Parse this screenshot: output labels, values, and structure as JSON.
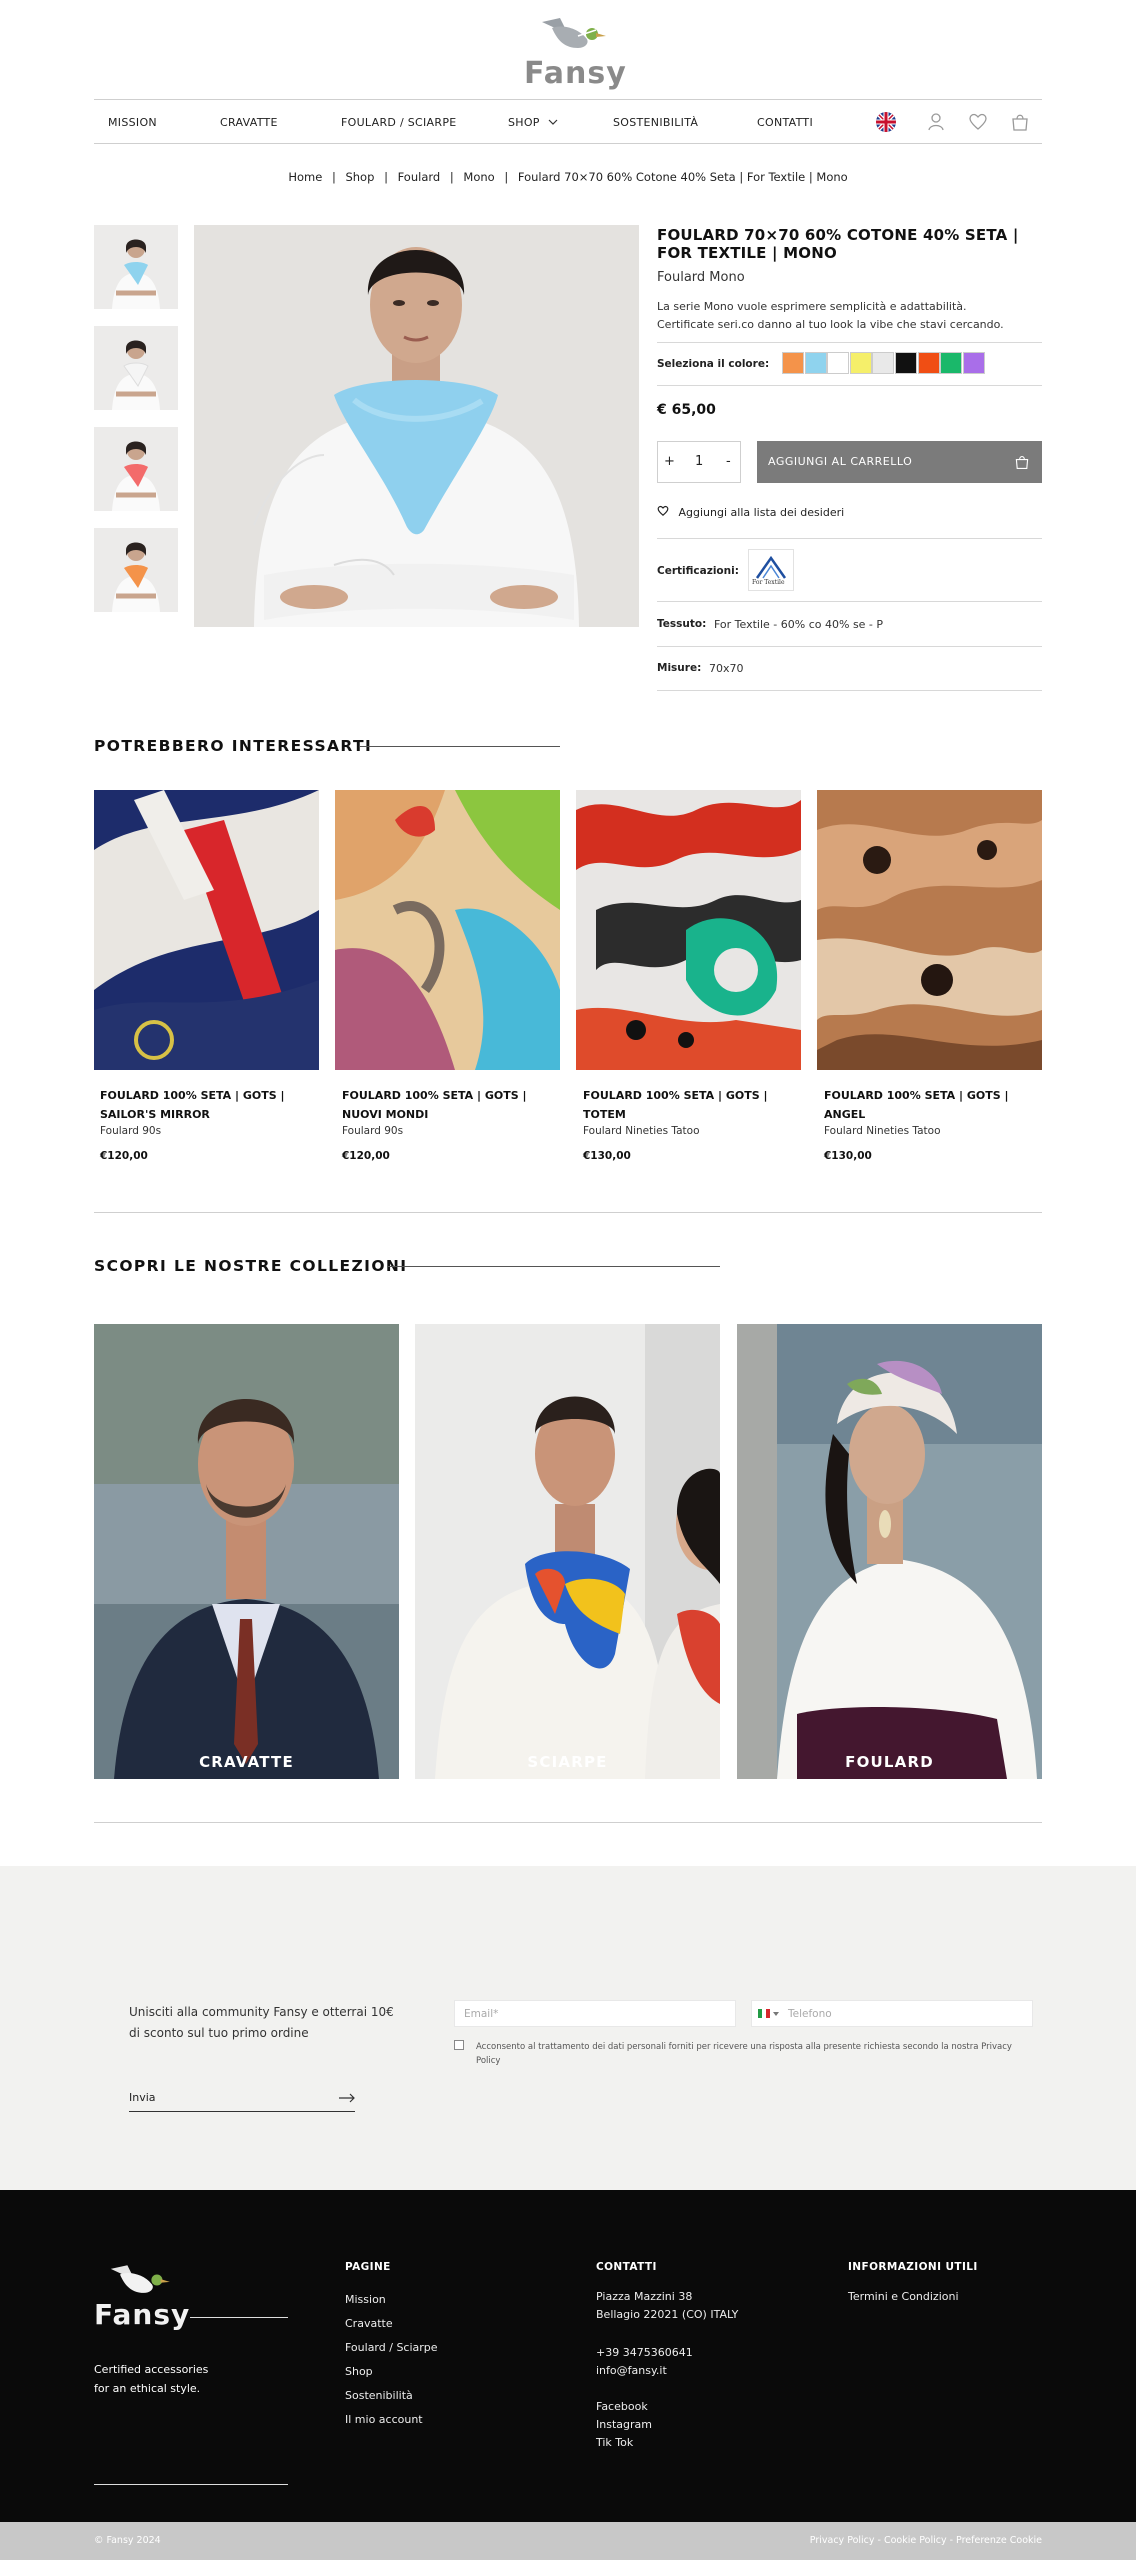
{
  "brand": {
    "name": "Fansy"
  },
  "nav": {
    "mission": "MISSION",
    "cravatte": "CRAVATTE",
    "foulard": "FOULARD / SCIARPE",
    "shop": "SHOP",
    "sostenibilita": "SOSTENIBILITÀ",
    "contatti": "CONTATTI"
  },
  "breadcrumb": {
    "home": "Home",
    "shop": "Shop",
    "foulard": "Foulard",
    "mono": "Mono",
    "current": "Foulard 70×70 60% Cotone 40% Seta | For Textile | Mono",
    "sep": "|"
  },
  "product": {
    "title": "FOULARD 70×70 60% COTONE 40% SETA | FOR TEXTILE | MONO",
    "subtitle": "Foulard Mono",
    "desc1": "La serie Mono vuole esprimere semplicità e adattabilità.",
    "desc2": "Certificate seri.co danno al tuo look la vibe che stavi cercando.",
    "color_label": "Seleziona il colore:",
    "colors": [
      "#f4934a",
      "#8fd3ee",
      "#ffffff",
      "#f5ef6a",
      "#e9e9e9",
      "#111111",
      "#f04e14",
      "#1ab86a",
      "#a96ee9"
    ],
    "price": "€ 65,00",
    "qty_plus": "+",
    "qty_value": "1",
    "qty_minus": "-",
    "add_to_cart": "AGGIUNGI AL CARRELLO",
    "wishlist": "Aggiungi alla lista dei desideri",
    "cert_label": "Certificazioni:",
    "cert_logo_text": "For Textile",
    "fabric_label": "Tessuto:",
    "fabric_value": "For Textile - 60% co 40% se - P",
    "size_label": "Misure:",
    "size_value": "70x70"
  },
  "related": {
    "heading": "POTREBBERO INTERESSARTI",
    "items": [
      {
        "title1": "FOULARD 100% SETA | GOTS |",
        "title2": "SAILOR'S MIRROR",
        "sub": "Foulard 90s",
        "price": "€120,00"
      },
      {
        "title1": "FOULARD 100% SETA | GOTS |",
        "title2": "NUOVI MONDI",
        "sub": "Foulard 90s",
        "price": "€120,00"
      },
      {
        "title1": "FOULARD 100% SETA | GOTS |",
        "title2": "TOTEM",
        "sub": "Foulard Nineties Tatoo",
        "price": "€130,00"
      },
      {
        "title1": "FOULARD 100% SETA | GOTS |",
        "title2": "ANGEL",
        "sub": "Foulard Nineties Tatoo",
        "price": "€130,00"
      }
    ]
  },
  "collections": {
    "heading": "SCOPRI LE NOSTRE COLLEZIONI",
    "items": [
      "CRAVATTE",
      "SCIARPE",
      "FOULARD"
    ]
  },
  "newsletter": {
    "line1": "Unisciti alla community Fansy e otterrai 10€",
    "line2": "di sconto sul tuo primo ordine",
    "email_placeholder": "Email*",
    "phone_placeholder": "Telefono",
    "consent": "Acconsento al trattamento dei dati personali forniti per ricevere una risposta alla presente richiesta secondo la nostra Privacy Policy",
    "submit": "Invia"
  },
  "footer": {
    "tagline1": "Certified accessories",
    "tagline2": "for an ethical style.",
    "pagine_head": "PAGINE",
    "pagine": [
      "Mission",
      "Cravatte",
      "Foulard / Sciarpe",
      "Shop",
      "Sostenibilità",
      "Il mio account"
    ],
    "contatti_head": "CONTATTI",
    "address1": "Piazza Mazzini 38",
    "address2": "Bellagio 22021 (CO) ITALY",
    "phone": "+39 3475360641",
    "email": "info@fansy.it",
    "social": [
      "Facebook",
      "Instagram",
      "Tik Tok"
    ],
    "info_head": "INFORMAZIONI UTILI",
    "terms": "Termini e Condizioni",
    "copyright": "© Fansy 2024",
    "legal": "Privacy Policy - Cookie Policy - Preferenze Cookie"
  }
}
